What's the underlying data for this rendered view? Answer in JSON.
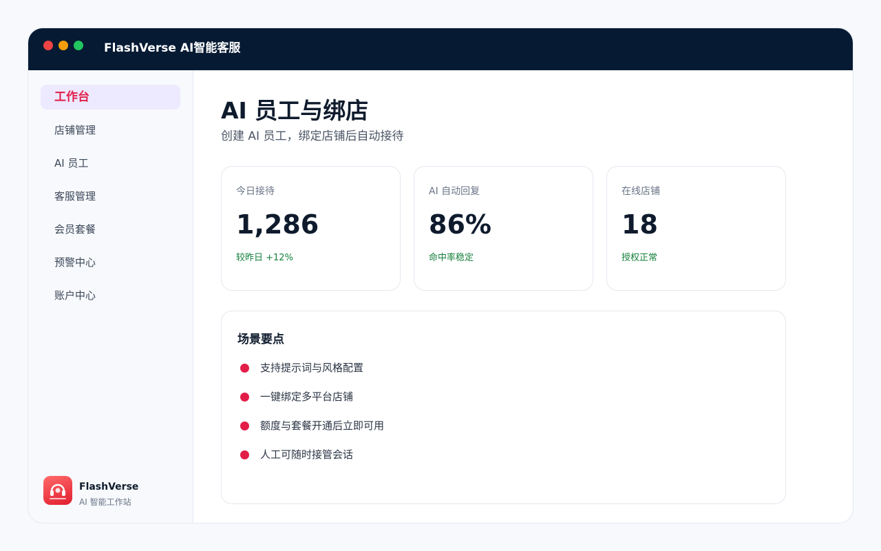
{
  "app": {
    "title": "FlashVerse AI智能客服"
  },
  "sidebar": {
    "items": [
      {
        "label": "工作台",
        "active": true
      },
      {
        "label": "店铺管理"
      },
      {
        "label": "AI 员工"
      },
      {
        "label": "客服管理"
      },
      {
        "label": "会员套餐"
      },
      {
        "label": "预警中心"
      },
      {
        "label": "账户中心"
      }
    ],
    "brand": {
      "name": "FlashVerse",
      "subtitle": "AI 智能工作站",
      "logo_icon": "headset-logo-icon"
    }
  },
  "main": {
    "title": "AI 员工与绑店",
    "subtitle": "创建 AI 员工，绑定店铺后自动接待",
    "stats": [
      {
        "label": "今日接待",
        "value": "1,286",
        "note": "较昨日 +12%"
      },
      {
        "label": "AI 自动回复",
        "value": "86%",
        "note": "命中率稳定"
      },
      {
        "label": "在线店铺",
        "value": "18",
        "note": "授权正常"
      }
    ],
    "points": {
      "title": "场景要点",
      "items": [
        "支持提示词与风格配置",
        "一键绑定多平台店铺",
        "额度与套餐开通后立即可用",
        "人工可随时接管会话"
      ]
    }
  },
  "colors": {
    "titlebar": "#061a33",
    "accent": "#e11d48",
    "active_bg": "#ede9fe",
    "positive": "#15803d"
  }
}
